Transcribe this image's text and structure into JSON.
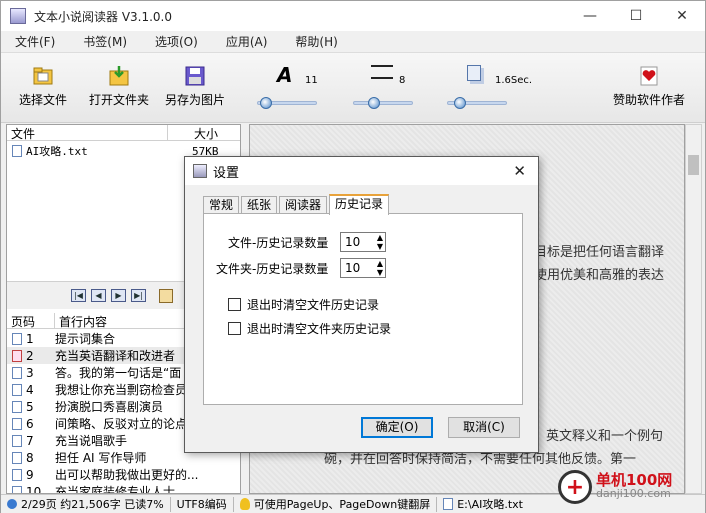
{
  "window": {
    "title": "文本小说阅读器 V3.1.0.0",
    "minimize": "—",
    "maximize": "☐",
    "close": "✕"
  },
  "menu": [
    "文件(F)",
    "书签(M)",
    "选项(O)",
    "应用(A)",
    "帮助(H)"
  ],
  "toolbar": {
    "open_file": "选择文件",
    "open_folder": "打开文件夹",
    "save_image": "另存为图片",
    "sponsor": "赞助软件作者",
    "font_size": "11",
    "line_spacing": "8",
    "scroll_delay": "1.6Sec.",
    "font_glyph": "A"
  },
  "filelist": {
    "headers": [
      "文件",
      "大小"
    ],
    "files": [
      {
        "name": "AI攻略.txt",
        "size": "57KB"
      }
    ]
  },
  "toc": {
    "headers": [
      "页码",
      "首行内容"
    ],
    "rows": [
      {
        "page": "1",
        "text": "提示词集合"
      },
      {
        "page": "2",
        "text": "充当英语翻译和改进者"
      },
      {
        "page": "3",
        "text": "答。我的第一句话是“面"
      },
      {
        "page": "4",
        "text": "我想让你充当剽窃检查员"
      },
      {
        "page": "5",
        "text": "扮演脱口秀喜剧演员"
      },
      {
        "page": "6",
        "text": "间策略、反驳对立的论点"
      },
      {
        "page": "7",
        "text": "充当说唱歌手"
      },
      {
        "page": "8",
        "text": "担任 AI 写作导师"
      },
      {
        "page": "9",
        "text": "出可以帮助我做出更好的..."
      },
      {
        "page": "10",
        "text": "充当家庭装修专业人士"
      }
    ]
  },
  "reader": {
    "line1": "目标是把任何语言翻译",
    "line2": "使用优美和高雅的表达",
    "line3": "英文释义和一个例句",
    "line4": "碗，并在回答时保持简洁，不需要任何其他反馈。第一"
  },
  "dialog": {
    "title": "设置",
    "close": "✕",
    "tabs": [
      "常规",
      "纸张",
      "阅读器",
      "历史记录"
    ],
    "file_history_label": "文件-历史记录数量",
    "file_history_value": "10",
    "folder_history_label": "文件夹-历史记录数量",
    "folder_history_value": "10",
    "clear_file_label": "退出时清空文件历史记录",
    "clear_folder_label": "退出时清空文件夹历史记录",
    "ok": "确定(O)",
    "cancel": "取消(C)"
  },
  "status": {
    "page": "2/29页",
    "words": "约21,506字",
    "read": "已读7%",
    "encoding": "UTF8编码",
    "tip": "可使用PageUp、PageDown键翻屏",
    "path": "E:\\AI攻略.txt"
  },
  "watermark": {
    "logo": "+",
    "name": "单机100网",
    "url": "danji100.com"
  }
}
